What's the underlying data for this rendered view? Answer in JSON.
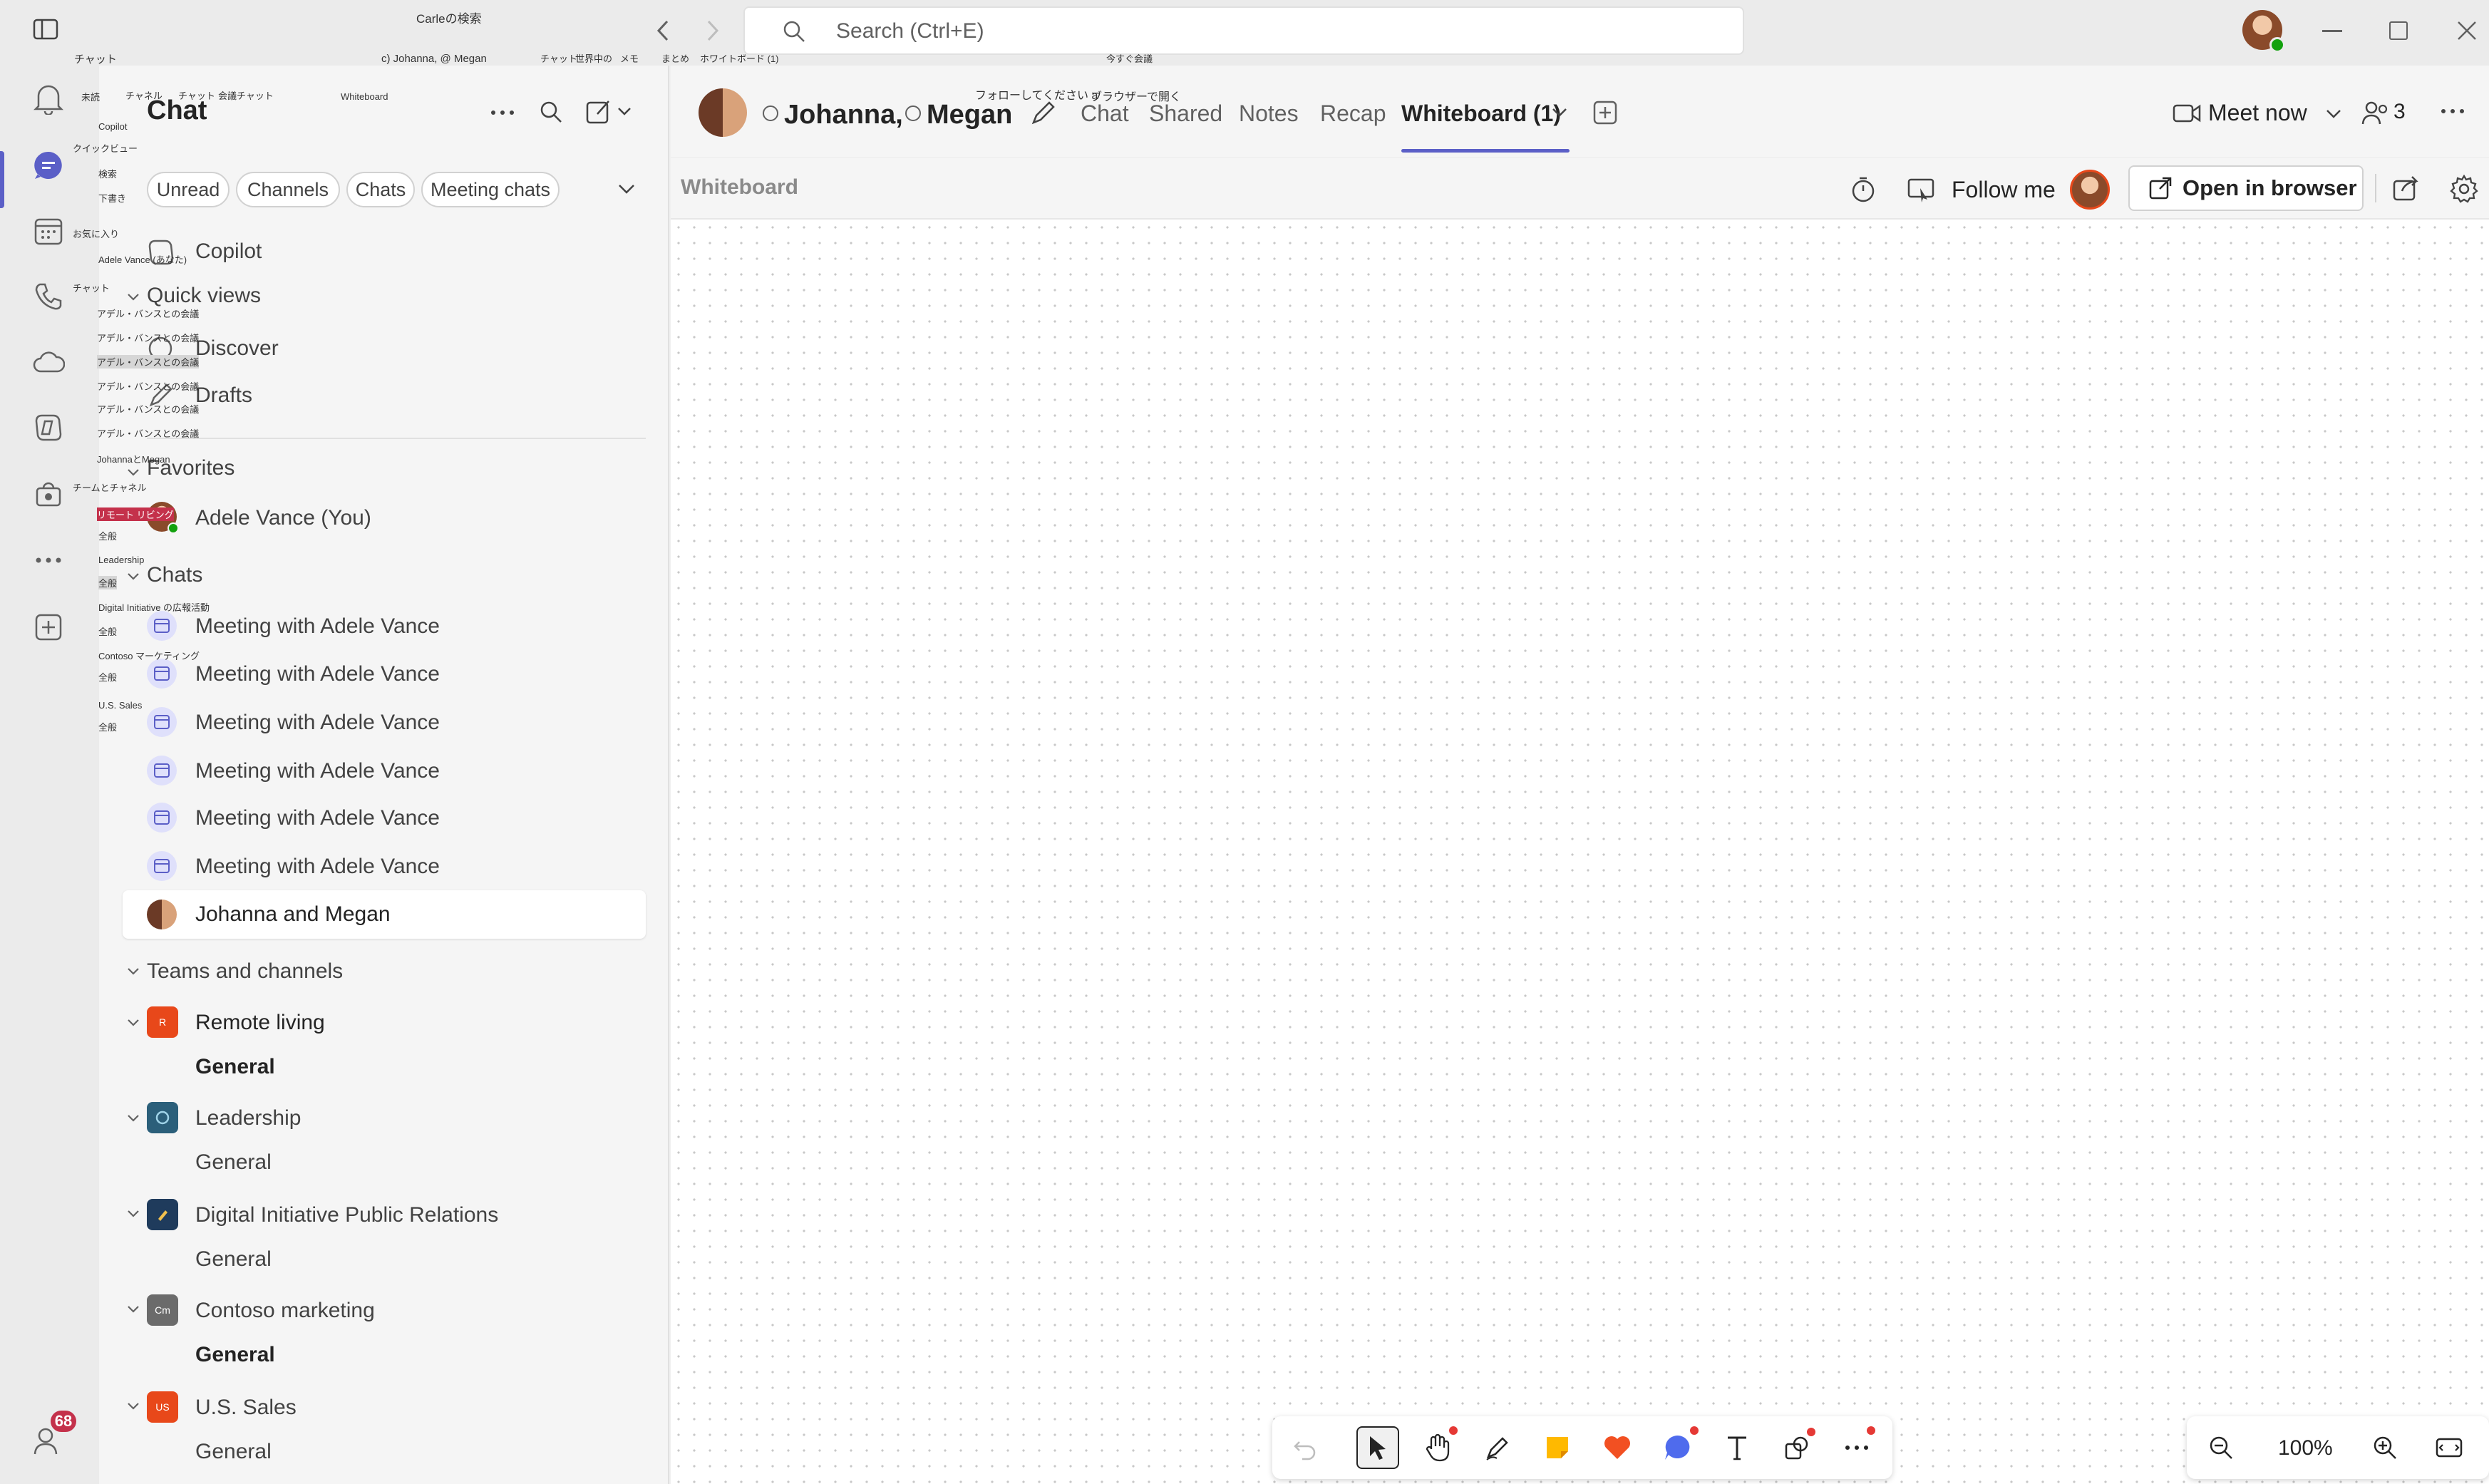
{
  "search": {
    "placeholder": "Search (Ctrl+E)"
  },
  "overlay_labels": {
    "top_search": "Carleの検索",
    "rail_chat": "チャット",
    "header_names": "c) Johanna, @ Megan",
    "tab_chat": "チャット",
    "tab_shared": "世界中の",
    "tab_notes": "メモ",
    "tab_recap": "まとめ",
    "tab_whiteboard": "ホワイトボード (1)",
    "meet_now": "今すぐ会議",
    "follow_me": "フォローしてください a",
    "open_in_browser": "ブラウザーで開く",
    "whiteboard": "Whiteboard",
    "unread": "未読",
    "channels": "チャネル",
    "chats": "チャット",
    "meeting_chats": "会議チャット",
    "copilot": "Copilot",
    "quick_views": "クイックビュー",
    "discover": "検索",
    "drafts": "下書き",
    "favorites": "お気に入り",
    "adele_you": "Adele Vance (あなた)",
    "chats_section": "チャット",
    "meeting_1": "アデル・バンスとの会議",
    "meeting_2": "アデル・バンスとの会議",
    "meeting_3": "アデル・バンスとの会議",
    "meeting_4": "アデル・バンスとの会議",
    "meeting_5": "アデル・バンスとの会議",
    "meeting_6": "アデル・バンスとの会議",
    "johanna_megan": "JohannaとMegan",
    "teams_channels": "チームとチャネル",
    "remote_living": "リモート リビング",
    "general_1": "全般",
    "leadership": "Leadership",
    "general_2": "全般",
    "digital": "Digital Initiative の広報活動",
    "general_3": "全般",
    "contoso": "Contoso マーケティング",
    "general_4": "全般",
    "us_sales": "U.S. Sales",
    "general_5": "全般"
  },
  "chat_pane": {
    "title": "Chat",
    "filters": [
      "Unread",
      "Channels",
      "Chats",
      "Meeting chats"
    ],
    "copilot": "Copilot",
    "quick_views": "Quick views",
    "discover": "Discover",
    "drafts": "Drafts",
    "favorites": "Favorites",
    "favorite_user": "Adele Vance (You)",
    "chats_header": "Chats",
    "meetings": [
      "Meeting with Adele Vance",
      "Meeting with Adele Vance",
      "Meeting with Adele Vance",
      "Meeting with Adele Vance",
      "Meeting with Adele Vance",
      "Meeting with Adele Vance"
    ],
    "selected_chat": "Johanna and Megan",
    "teams_header": "Teams and channels",
    "teams": [
      {
        "name": "Remote living",
        "channel": "General",
        "color": "#e8481a",
        "abbr": "R"
      },
      {
        "name": "Leadership",
        "channel": "General",
        "color": "#2b5f7a",
        "abbr": ""
      },
      {
        "name": "Digital Initiative Public Relations",
        "channel": "General",
        "color": "#1f3b5c",
        "abbr": ""
      },
      {
        "name": "Contoso marketing",
        "channel": "General",
        "color": "#6b6b6b",
        "abbr": "Cm"
      },
      {
        "name": "U.S. Sales",
        "channel": "General",
        "color": "#e8481a",
        "abbr": "US"
      }
    ]
  },
  "header": {
    "name1": "Johanna,",
    "name2": "Megan",
    "tabs": [
      "Chat",
      "Shared",
      "Notes",
      "Recap"
    ],
    "active_tab": "Whiteboard (1)",
    "meet_now": "Meet now",
    "participants": "3"
  },
  "whiteboard_toolbar": {
    "title": "Whiteboard",
    "follow_me": "Follow me",
    "open_in_browser": "Open in browser"
  },
  "zoom": {
    "level": "100%"
  },
  "notifications": {
    "badge": "68"
  },
  "colors": {
    "accent": "#5b5fc7",
    "badge": "#c4314b",
    "heart": "#f25022",
    "note": "#ffb900"
  }
}
